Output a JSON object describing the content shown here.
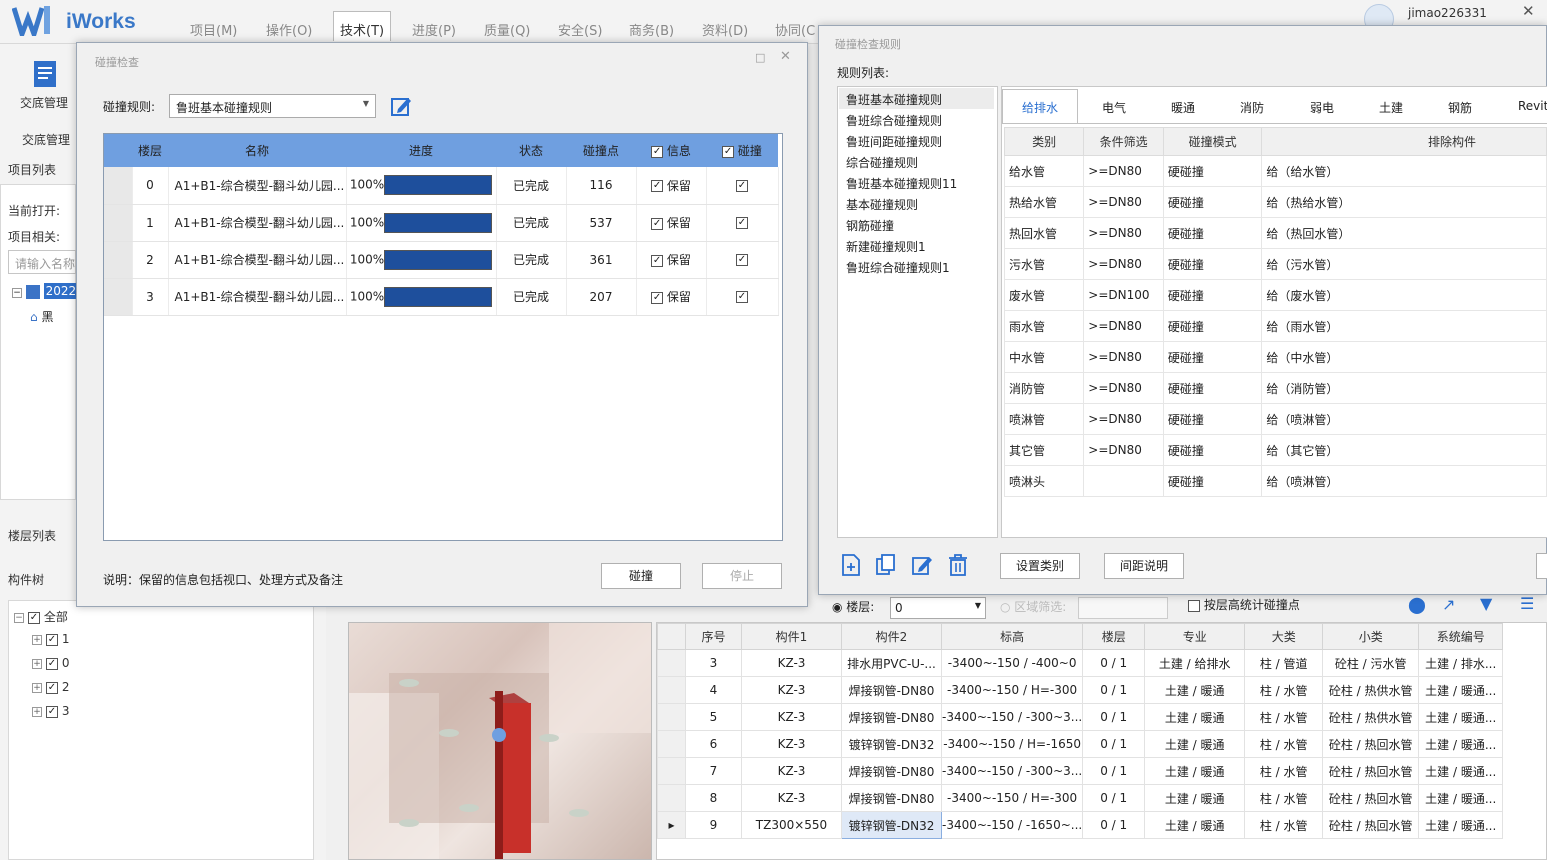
{
  "app": {
    "title": "iWorks",
    "username": "jimao226331",
    "menus": [
      {
        "label": "项目(M)"
      },
      {
        "label": "操作(O)"
      },
      {
        "label": "技术(T)"
      },
      {
        "label": "进度(P)"
      },
      {
        "label": "质量(Q)"
      },
      {
        "label": "安全(S)"
      },
      {
        "label": "商务(B)"
      },
      {
        "label": "资料(D)"
      },
      {
        "label": "协同(C"
      }
    ]
  },
  "left": {
    "ribbon_label": "交底管理",
    "section_label": "交底管理",
    "project_list": "项目列表",
    "current_open": "当前打开:",
    "project_related": "项目相关:",
    "search_placeholder": "请输入名称",
    "tree_root": "2022",
    "tree_child": "黑",
    "floor_list": "楼层列表",
    "component_tree": "构件树",
    "tree_items": [
      {
        "label": "全部"
      },
      {
        "label": "1"
      },
      {
        "label": "0"
      },
      {
        "label": "2"
      },
      {
        "label": "3"
      }
    ]
  },
  "clash_dialog": {
    "title": "碰撞检查",
    "rule_label": "碰撞规则:",
    "rule_value": "鲁班基本碰撞规则",
    "columns": {
      "floor": "楼层",
      "name": "名称",
      "progress": "进度",
      "status": "状态",
      "points": "碰撞点",
      "info": "信息",
      "clash": "碰撞"
    },
    "rows": [
      {
        "floor": "0",
        "name": "A1+B1-综合模型-翻斗幼儿园...",
        "progress": "100%",
        "status": "已完成",
        "points": "116",
        "info": "保留"
      },
      {
        "floor": "1",
        "name": "A1+B1-综合模型-翻斗幼儿园...",
        "progress": "100%",
        "status": "已完成",
        "points": "537",
        "info": "保留"
      },
      {
        "floor": "2",
        "name": "A1+B1-综合模型-翻斗幼儿园...",
        "progress": "100%",
        "status": "已完成",
        "points": "361",
        "info": "保留"
      },
      {
        "floor": "3",
        "name": "A1+B1-综合模型-翻斗幼儿园...",
        "progress": "100%",
        "status": "已完成",
        "points": "207",
        "info": "保留"
      }
    ],
    "note": "说明：保留的信息包括视口、处理方式及备注",
    "clash_button": "碰撞",
    "stop_button": "停止"
  },
  "rules_dialog": {
    "title": "碰撞检查规则",
    "list_label": "规则列表:",
    "rules": [
      {
        "label": "鲁班基本碰撞规则"
      },
      {
        "label": "鲁班综合碰撞规则"
      },
      {
        "label": "鲁班间距碰撞规则"
      },
      {
        "label": "综合碰撞规则"
      },
      {
        "label": "鲁班基本碰撞规则11"
      },
      {
        "label": "基本碰撞规则"
      },
      {
        "label": "钢筋碰撞"
      },
      {
        "label": "新建碰撞规则1"
      },
      {
        "label": "鲁班综合碰撞规则1"
      }
    ],
    "tabs": [
      {
        "label": "给排水"
      },
      {
        "label": "电气"
      },
      {
        "label": "暖通"
      },
      {
        "label": "消防"
      },
      {
        "label": "弱电"
      },
      {
        "label": "土建"
      },
      {
        "label": "钢筋"
      },
      {
        "label": "Revit"
      }
    ],
    "columns": {
      "category": "类别",
      "filter": "条件筛选",
      "mode": "碰撞模式",
      "exclude": "排除构件"
    },
    "rows": [
      {
        "category": "给水管",
        "filter": ">=DN80",
        "mode": "硬碰撞",
        "exclude": "给（给水管）"
      },
      {
        "category": "热给水管",
        "filter": ">=DN80",
        "mode": "硬碰撞",
        "exclude": "给（热给水管）"
      },
      {
        "category": "热回水管",
        "filter": ">=DN80",
        "mode": "硬碰撞",
        "exclude": "给（热回水管）"
      },
      {
        "category": "污水管",
        "filter": ">=DN80",
        "mode": "硬碰撞",
        "exclude": "给（污水管）"
      },
      {
        "category": "废水管",
        "filter": ">=DN100",
        "mode": "硬碰撞",
        "exclude": "给（废水管）"
      },
      {
        "category": "雨水管",
        "filter": ">=DN80",
        "mode": "硬碰撞",
        "exclude": "给（雨水管）"
      },
      {
        "category": "中水管",
        "filter": ">=DN80",
        "mode": "硬碰撞",
        "exclude": "给（中水管）"
      },
      {
        "category": "消防管",
        "filter": ">=DN80",
        "mode": "硬碰撞",
        "exclude": "给（消防管）"
      },
      {
        "category": "喷淋管",
        "filter": ">=DN80",
        "mode": "硬碰撞",
        "exclude": "给（喷淋管）"
      },
      {
        "category": "其它管",
        "filter": ">=DN80",
        "mode": "硬碰撞",
        "exclude": "给（其它管）"
      },
      {
        "category": "喷淋头",
        "filter": "",
        "mode": "硬碰撞",
        "exclude": "给（喷淋管）"
      }
    ],
    "set_category_button": "设置类别",
    "spacing_note_button": "间距说明"
  },
  "filterbar": {
    "floor_label": "楼层:",
    "floor_value": "0",
    "region_label": "区域筛选:",
    "stat_label": "按层高统计碰撞点"
  },
  "results": {
    "columns": [
      "序号",
      "构件1",
      "构件2",
      "标高",
      "楼层",
      "专业",
      "大类",
      "小类",
      "系统编号"
    ],
    "rows": [
      [
        "3",
        "KZ-3",
        "排水用PVC-U-...",
        "-3400~-150 / -400~0",
        "0 / 1",
        "土建 / 给排水",
        "柱 / 管道",
        "砼柱 / 污水管",
        "土建 / 排水..."
      ],
      [
        "4",
        "KZ-3",
        "焊接钢管-DN80",
        "-3400~-150 / H=-300",
        "0 / 1",
        "土建 / 暖通",
        "柱 / 水管",
        "砼柱 / 热供水管",
        "土建 / 暖通..."
      ],
      [
        "5",
        "KZ-3",
        "焊接钢管-DN80",
        "-3400~-150 / -300~3...",
        "0 / 1",
        "土建 / 暖通",
        "柱 / 水管",
        "砼柱 / 热供水管",
        "土建 / 暖通..."
      ],
      [
        "6",
        "KZ-3",
        "镀锌钢管-DN32",
        "-3400~-150 / H=-1650",
        "0 / 1",
        "土建 / 暖通",
        "柱 / 水管",
        "砼柱 / 热回水管",
        "土建 / 暖通..."
      ],
      [
        "7",
        "KZ-3",
        "焊接钢管-DN80",
        "-3400~-150 / -300~3...",
        "0 / 1",
        "土建 / 暖通",
        "柱 / 水管",
        "砼柱 / 热回水管",
        "土建 / 暖通..."
      ],
      [
        "8",
        "KZ-3",
        "焊接钢管-DN80",
        "-3400~-150 / H=-300",
        "0 / 1",
        "土建 / 暖通",
        "柱 / 水管",
        "砼柱 / 热回水管",
        "土建 / 暖通..."
      ],
      [
        "9",
        "TZ300×550",
        "镀锌钢管-DN32",
        "-3400~-150 / -1650~...",
        "0 / 1",
        "土建 / 暖通",
        "柱 / 水管",
        "砼柱 / 热回水管",
        "土建 / 暖通..."
      ]
    ]
  },
  "colors": {
    "accent": "#2a6fd0",
    "header_blue": "#6f9fe0",
    "progress_fill": "#1e4f9c",
    "column_red": "#c8302a"
  }
}
